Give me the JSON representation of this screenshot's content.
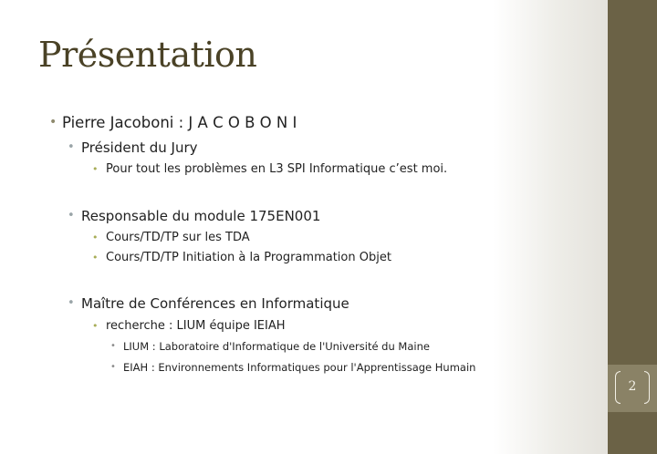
{
  "slide": {
    "title": "Présentation",
    "page_number": "2",
    "bullets": [
      {
        "level": 1,
        "text": "Pierre Jacoboni : J A C O B O N I"
      },
      {
        "level": 2,
        "text": "Président du Jury"
      },
      {
        "level": 3,
        "text": "Pour tout les problèmes en L3 SPI Informatique c’est moi."
      },
      {
        "level": 2,
        "text": "Responsable du module 175EN001"
      },
      {
        "level": 3,
        "text": "Cours/TD/TP sur les TDA"
      },
      {
        "level": 3,
        "text": "Cours/TD/TP Initiation à la Programmation Objet"
      },
      {
        "level": 2,
        "text": "Maître de Conférences en Informatique"
      },
      {
        "level": 3,
        "text": "recherche : LIUM équipe IEIAH"
      },
      {
        "level": 4,
        "text": "LIUM : Laboratoire d'Informatique de l'Université du Maine"
      },
      {
        "level": 4,
        "text": "EIAH : Environnements Informatiques pour l'Apprentissage Humain"
      }
    ],
    "bullet_glyph": "•",
    "colors": {
      "title": "#4a4226",
      "side_band": "#6b6246",
      "page_tab": "#8a8266",
      "bullet_level1": "#8f8a6e",
      "bullet_level2": "#9aa5a8",
      "bullet_level3": "#a8ad58",
      "bullet_level4": "#8c8c8c"
    }
  }
}
